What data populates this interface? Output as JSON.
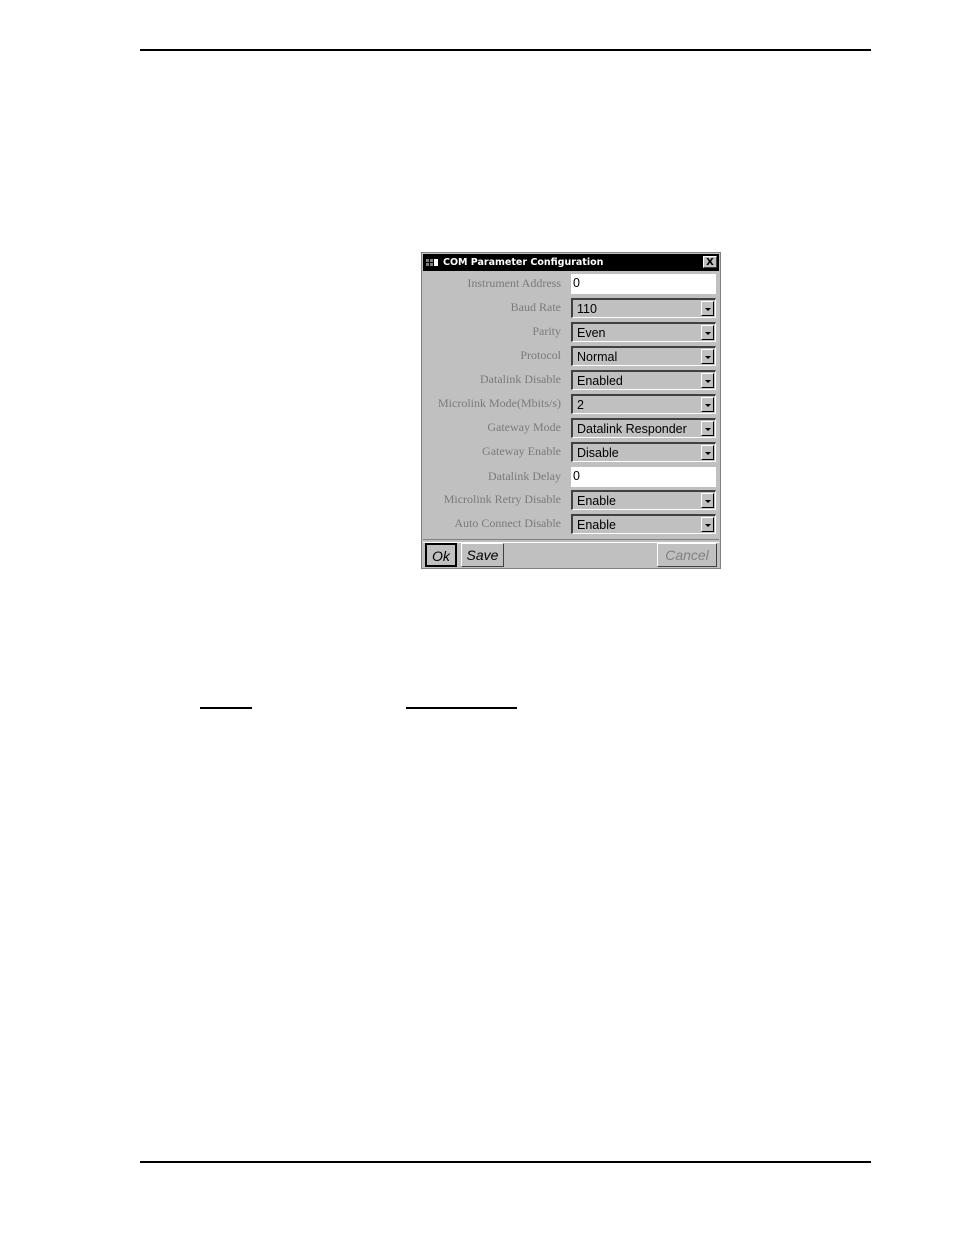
{
  "dialog": {
    "title": "COM Parameter Configuration",
    "close_label": "X",
    "fields": [
      {
        "label": "Instrument Address",
        "type": "text",
        "value": "0"
      },
      {
        "label": "Baud Rate",
        "type": "select",
        "value": "110"
      },
      {
        "label": "Parity",
        "type": "select",
        "value": "Even"
      },
      {
        "label": "Protocol",
        "type": "select",
        "value": "Normal"
      },
      {
        "label": "Datalink Disable",
        "type": "select",
        "value": "Enabled"
      },
      {
        "label": "Microlink Mode(Mbits/s)",
        "type": "select",
        "value": "2"
      },
      {
        "label": "Gateway Mode",
        "type": "select",
        "value": "Datalink Responder"
      },
      {
        "label": "Gateway Enable",
        "type": "select",
        "value": "Disable"
      },
      {
        "label": "Datalink Delay",
        "type": "text",
        "value": "0"
      },
      {
        "label": "Microlink Retry Disable",
        "type": "select",
        "value": "Enable"
      },
      {
        "label": "Auto Connect Disable",
        "type": "select",
        "value": "Enable"
      }
    ],
    "buttons": {
      "ok": "Ok",
      "save": "Save",
      "cancel": "Cancel"
    }
  }
}
